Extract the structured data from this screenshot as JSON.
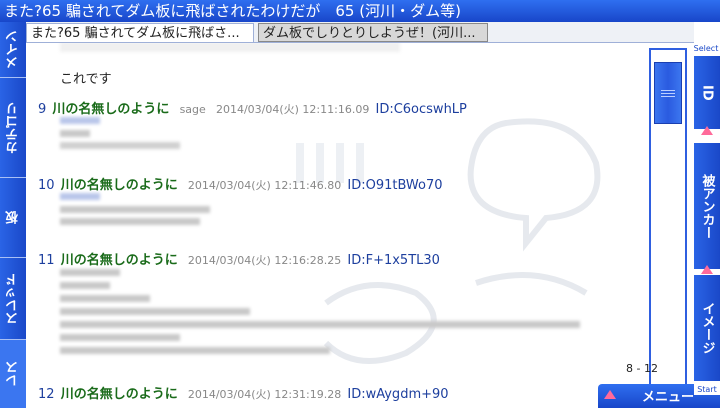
{
  "title": "また?65 騙されてダム板に飛ばされたわけだが　65 (河川・ダム等)",
  "tabs": [
    {
      "label": "また?65 騙されてダム板に飛ばさ..."
    },
    {
      "label": "ダム板でしりとりしようぜ！(河川..."
    }
  ],
  "left_nav": {
    "main": "メイン",
    "category": "カテゴリ",
    "board": "板",
    "thread": "スレッド",
    "res": "レス"
  },
  "right_nav": {
    "select": "Select",
    "id": "ID",
    "anchor": "被アンカー",
    "image": "イメージ"
  },
  "content": {
    "prev_body": "これです",
    "posts": [
      {
        "number": "9",
        "name": "川の名無しのように",
        "mail": "sage",
        "date": "2014/03/04(火) 12:11:16.09",
        "id": "ID:C6ocswhLP"
      },
      {
        "number": "10",
        "name": "川の名無しのように",
        "mail": "",
        "date": "2014/03/04(火) 12:11:46.80",
        "id": "ID:O91tBWo70"
      },
      {
        "number": "11",
        "name": "川の名無しのように",
        "mail": "",
        "date": "2014/03/04(火) 12:16:28.25",
        "id": "ID:F+1x5TL30"
      },
      {
        "number": "12",
        "name": "川の名無しのように",
        "mail": "",
        "date": "2014/03/04(火) 12:31:19.28",
        "id": "ID:wAygdm+90"
      }
    ]
  },
  "scrollbar": {
    "page_range": "8 - 12"
  },
  "menu": {
    "label": "メニュー",
    "start": "Start"
  },
  "colors": {
    "accent": "#1d4fd6",
    "name_green": "#1a6b1a",
    "arrow_pink": "#ff6a9a"
  }
}
